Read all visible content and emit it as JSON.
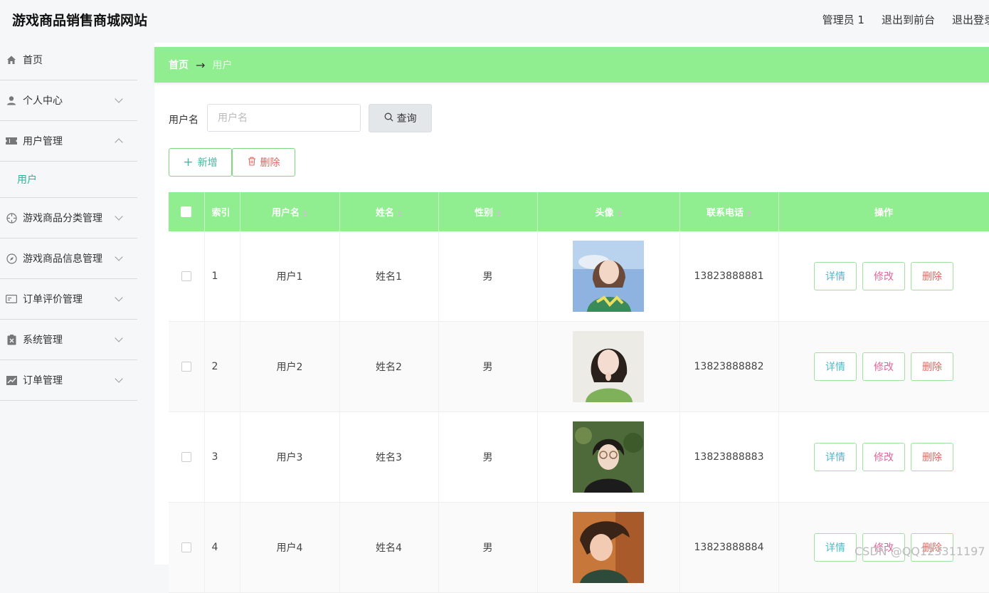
{
  "header": {
    "title": "游戏商品销售商城网站",
    "links": [
      "管理员 1",
      "退出到前台",
      "退出登录"
    ]
  },
  "sidebar": {
    "items": [
      {
        "label": "首页",
        "icon": "home-icon",
        "expandable": false
      },
      {
        "label": "个人中心",
        "icon": "user-icon",
        "expandable": true,
        "open": false
      },
      {
        "label": "用户管理",
        "icon": "ticket-icon",
        "expandable": true,
        "open": true,
        "children": [
          "用户"
        ]
      },
      {
        "label": "游戏商品分类管理",
        "icon": "crosshair-icon",
        "expandable": true,
        "open": false
      },
      {
        "label": "游戏商品信息管理",
        "icon": "compass-icon",
        "expandable": true,
        "open": false
      },
      {
        "label": "订单评价管理",
        "icon": "card-icon",
        "expandable": true,
        "open": false
      },
      {
        "label": "系统管理",
        "icon": "clipboard-icon",
        "expandable": true,
        "open": false
      },
      {
        "label": "订单管理",
        "icon": "chart-icon",
        "expandable": true,
        "open": false
      }
    ]
  },
  "breadcrumb": {
    "home": "首页",
    "arrow": "→",
    "current": "用户"
  },
  "search": {
    "label": "用户名",
    "placeholder": "用户名",
    "value": "",
    "button": "查询"
  },
  "actions": {
    "add": "新增",
    "delete": "删除"
  },
  "table": {
    "columns": [
      "索引",
      "用户名",
      "姓名",
      "性别",
      "头像",
      "联系电话",
      "操作"
    ],
    "rows": [
      {
        "index": "1",
        "username": "用户1",
        "name": "姓名1",
        "gender": "男",
        "phone": "13823888881"
      },
      {
        "index": "2",
        "username": "用户2",
        "name": "姓名2",
        "gender": "男",
        "phone": "13823888882"
      },
      {
        "index": "3",
        "username": "用户3",
        "name": "姓名3",
        "gender": "男",
        "phone": "13823888883"
      },
      {
        "index": "4",
        "username": "用户4",
        "name": "姓名4",
        "gender": "男",
        "phone": "13823888884"
      }
    ],
    "row_buttons": {
      "detail": "详情",
      "edit": "修改",
      "delete": "删除"
    }
  },
  "watermark": "CSDN @QQ123311197",
  "colors": {
    "accent": "#90ee90",
    "sub_active": "#27b59a"
  }
}
